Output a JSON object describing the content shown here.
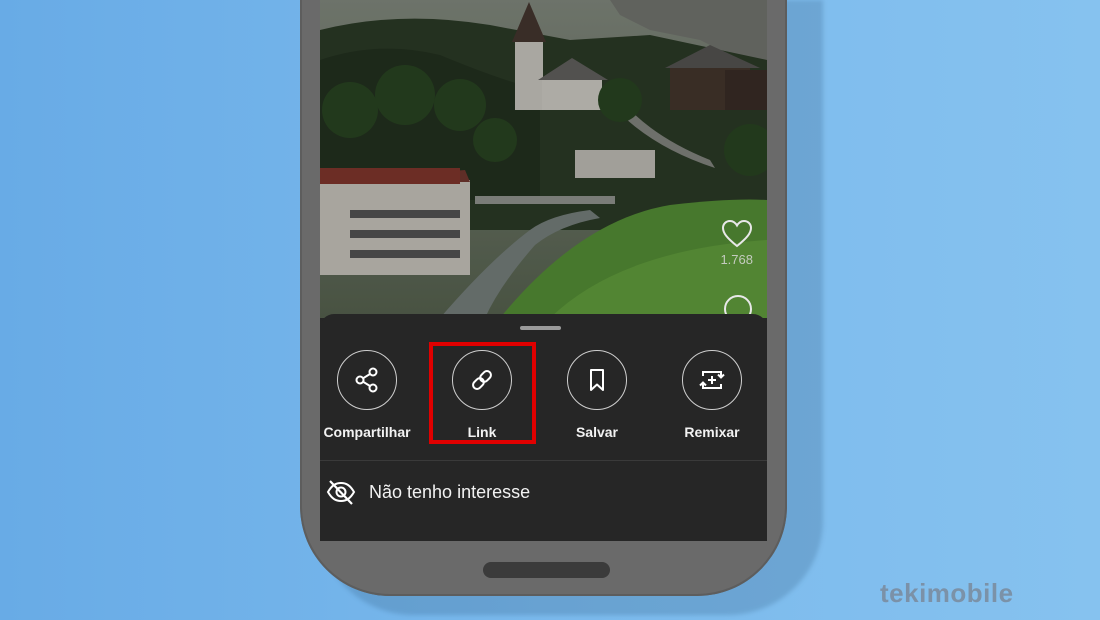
{
  "video": {
    "like_count": "1.768"
  },
  "share_sheet": {
    "actions": [
      {
        "label": "Compartilhar",
        "icon": "share-icon"
      },
      {
        "label": "Link",
        "icon": "link-icon"
      },
      {
        "label": "Salvar",
        "icon": "bookmark-icon"
      },
      {
        "label": "Remixar",
        "icon": "remix-icon"
      }
    ],
    "highlighted_action": "Link",
    "not_interested_label": "Não tenho interesse"
  },
  "watermark": "tekimobile",
  "colors": {
    "background": "#7ab9ec",
    "sheet": "#262626",
    "highlight": "#e00000",
    "phone_frame": "#6a6a6a"
  }
}
